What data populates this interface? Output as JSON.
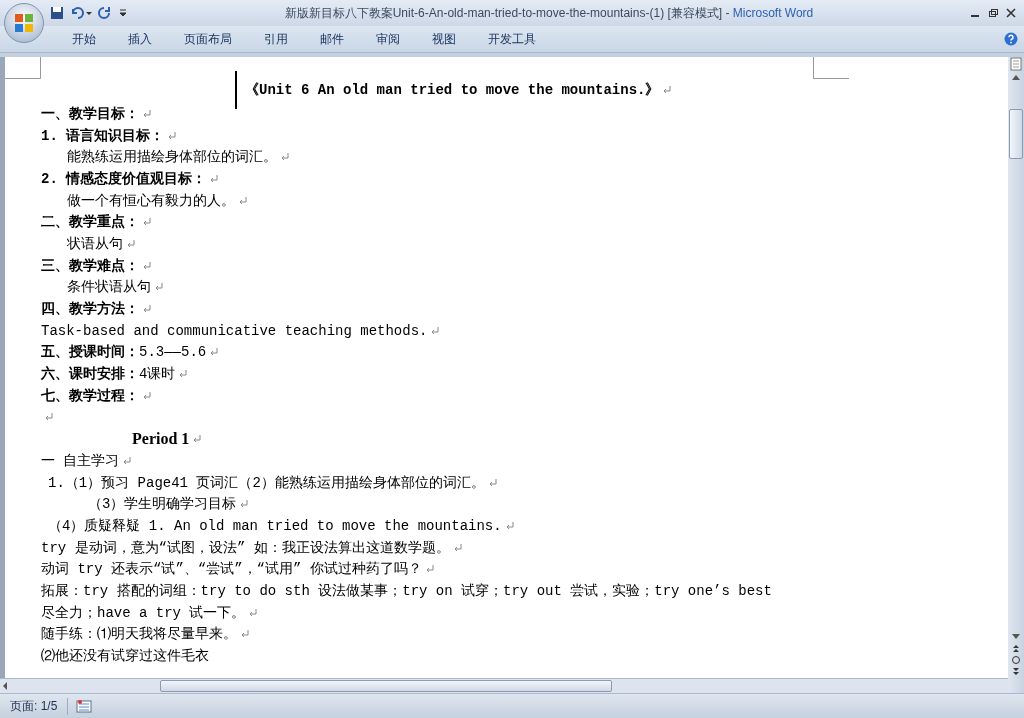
{
  "window": {
    "title": "新版新目标八下教案Unit-6-An-old-man-tried-to-move-the-mountains-(1) [兼容模式]",
    "separator": "-",
    "app": "Microsoft Word"
  },
  "ribbon_tabs": [
    {
      "label": "开始",
      "selected": false
    },
    {
      "label": "插入",
      "selected": false
    },
    {
      "label": "页面布局",
      "selected": false
    },
    {
      "label": "引用",
      "selected": false
    },
    {
      "label": "邮件",
      "selected": false
    },
    {
      "label": "审阅",
      "selected": false
    },
    {
      "label": "视图",
      "selected": false
    },
    {
      "label": "开发工具",
      "selected": false
    }
  ],
  "document": {
    "lines": [
      {
        "kind": "title",
        "text": "《Unit 6 An old man tried to move the mountains.》",
        "mark": true
      },
      {
        "kind": "heading",
        "text": "**一、教学目标：** ",
        "mark": true
      },
      {
        "kind": "heading",
        "text": "**1. 语言知识目标：**",
        "mark": true
      },
      {
        "kind": "sub",
        "text": "能熟练运用描绘身体部位的词汇。",
        "mark": true
      },
      {
        "kind": "heading",
        "text": "**2. 情感态度价值观目标：**",
        "mark": true
      },
      {
        "kind": "sub",
        "text": "做一个有恒心有毅力的人。",
        "mark": true
      },
      {
        "kind": "heading",
        "text": "**二、教学重点：**",
        "mark": true
      },
      {
        "kind": "sub",
        "text": "状语从句",
        "mark": true
      },
      {
        "kind": "heading",
        "text": "**三、教学难点：**",
        "mark": true
      },
      {
        "kind": "sub",
        "text": "条件状语从句",
        "mark": true
      },
      {
        "kind": "heading",
        "text": "**四、教学方法：**",
        "mark": true
      },
      {
        "kind": "heading",
        "text": "Task-based and communicative teaching methods.",
        "mark": true
      },
      {
        "kind": "heading",
        "text": "**五、授课时间：**5.3——5.6",
        "mark": true
      },
      {
        "kind": "heading",
        "text": "**六、课时安排：**4课时",
        "mark": true
      },
      {
        "kind": "heading",
        "text": "**七、教学过程：**",
        "mark": true
      },
      {
        "kind": "blank",
        "mark": true
      },
      {
        "kind": "period",
        "text": "Period 1",
        "mark": true
      },
      {
        "kind": "heading",
        "text": "一 自主学习 ",
        "mark": true
      },
      {
        "kind": "item",
        "text": "1.（1）预习 Page41 页词汇（2）能熟练运用描绘身体部位的词汇。",
        "mark": true
      },
      {
        "kind": "subitem",
        "text": "（3）学生明确学习目标",
        "mark": true
      },
      {
        "kind": "item",
        "text": "（4）质疑释疑 1. An old man tried to move the mountains.",
        "mark": true
      },
      {
        "kind": "heading",
        "text": "try 是动词，意为“试图，设法”  如：我正设法算出这道数学题。",
        "mark": true
      },
      {
        "kind": "heading",
        "text": "动词 try 还表示“试”、“尝试”，“试用”    你试过种药了吗？",
        "mark": true
      },
      {
        "kind": "heading",
        "text": "拓展：try 搭配的词组：try to do sth 设法做某事；try on 试穿；try out 尝试，实验；try one’s best",
        "mark": false
      },
      {
        "kind": "heading",
        "text": "尽全力；have a try 试一下。",
        "mark": true
      },
      {
        "kind": "heading",
        "text": "随手练：⑴明天我将尽量早来。",
        "mark": true
      },
      {
        "kind": "heading",
        "text": "⑵他还没有试穿过这件毛衣",
        "mark": false
      }
    ]
  },
  "status_bar": {
    "page": "页面: 1/5"
  }
}
